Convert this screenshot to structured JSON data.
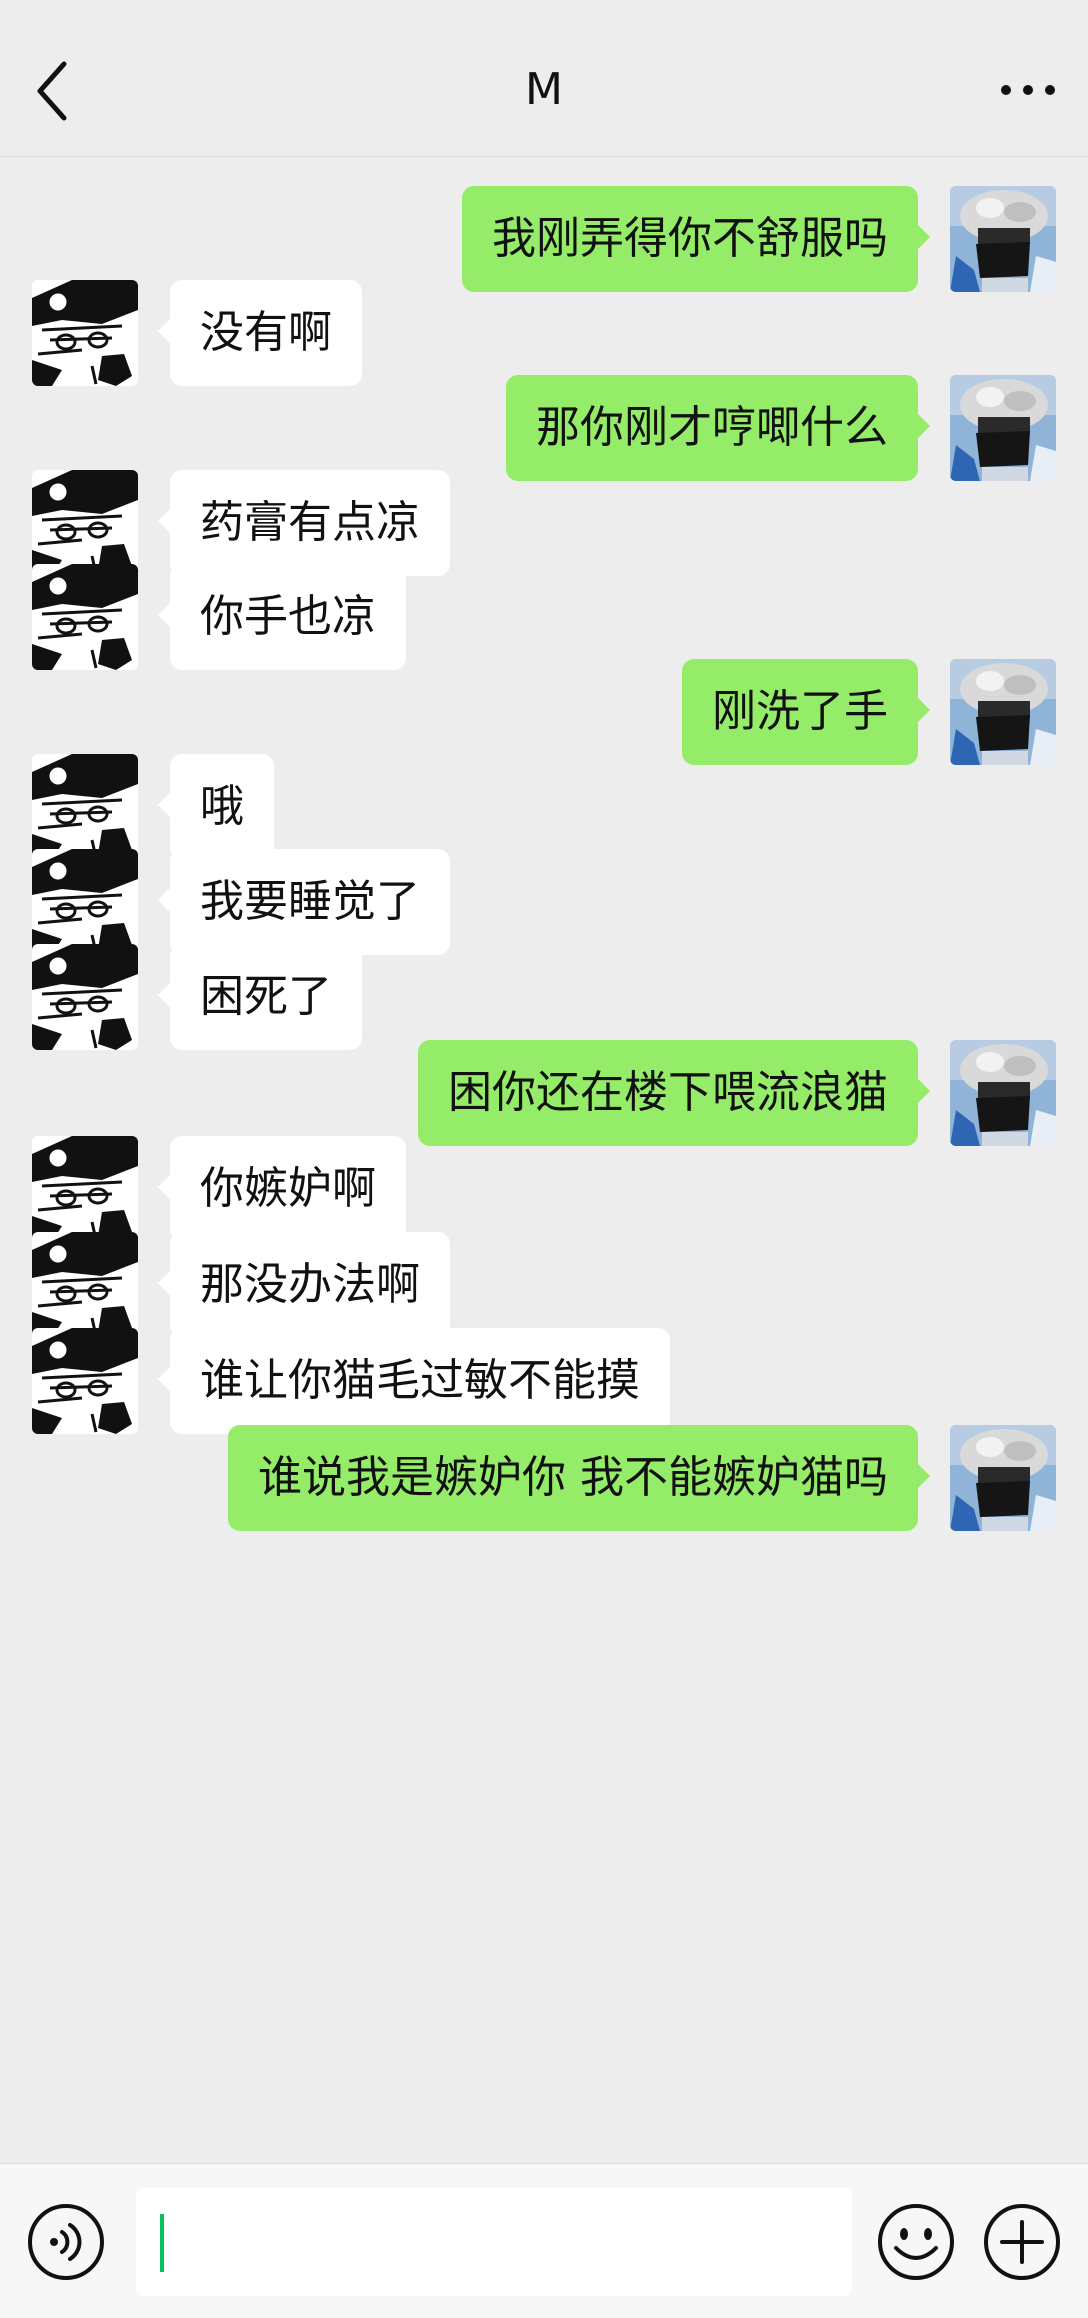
{
  "header": {
    "title": "M",
    "back_icon": "chevron-left-icon",
    "more_icon": "ellipsis-icon"
  },
  "messages": [
    {
      "side": "right",
      "text": "我刚弄得你不舒服吗"
    },
    {
      "side": "left",
      "text": "没有啊"
    },
    {
      "side": "right",
      "text": "那你刚才哼唧什么"
    },
    {
      "side": "left",
      "text": "药膏有点凉"
    },
    {
      "side": "left",
      "text": "你手也凉"
    },
    {
      "side": "right",
      "text": "刚洗了手"
    },
    {
      "side": "left",
      "text": "哦"
    },
    {
      "side": "left",
      "text": "我要睡觉了"
    },
    {
      "side": "left",
      "text": "困死了"
    },
    {
      "side": "right",
      "text": "困你还在楼下喂流浪猫"
    },
    {
      "side": "left",
      "text": "你嫉妒啊"
    },
    {
      "side": "left",
      "text": "那没办法啊"
    },
    {
      "side": "left",
      "text": "谁让你猫毛过敏不能摸"
    },
    {
      "side": "right",
      "text": "谁说我是嫉妒你 我不能嫉妒猫吗"
    }
  ],
  "input": {
    "value": "",
    "placeholder": ""
  },
  "toolbar": {
    "voice_icon": "voice-icon",
    "emoji_icon": "emoji-icon",
    "plus_icon": "plus-icon"
  },
  "colors": {
    "background": "#ededed",
    "sent_bubble": "#95ec69",
    "received_bubble": "#ffffff",
    "cursor": "#07c160"
  }
}
